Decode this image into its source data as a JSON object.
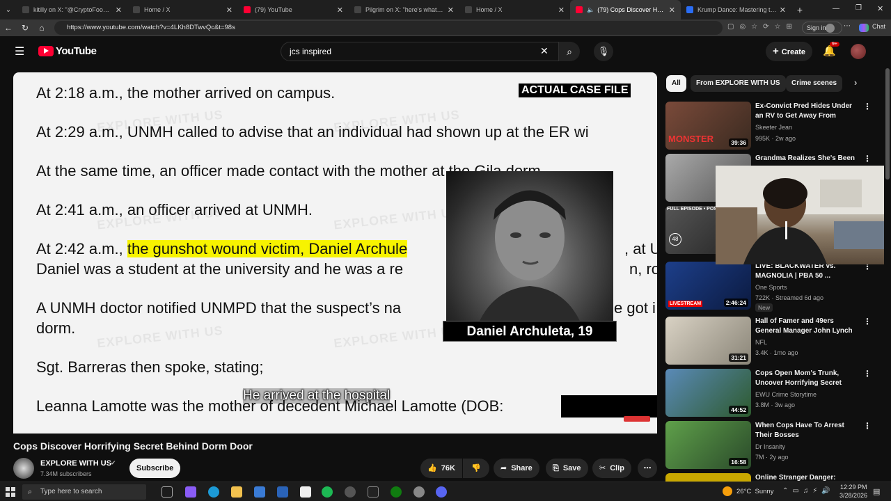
{
  "browser": {
    "tabs": [
      {
        "title": "kitilly on X: \"@CryptoFooo @Fea",
        "color": "#444"
      },
      {
        "title": "Home / X",
        "color": "#444"
      },
      {
        "title": "(79) YouTube",
        "color": "#ff0033"
      },
      {
        "title": "Pilgrim on X: \"here's what clavicul",
        "color": "#444"
      },
      {
        "title": "Home / X",
        "color": "#444"
      },
      {
        "title": "(79) Cops Discover Horrifying",
        "color": "#ff0033"
      },
      {
        "title": "Krump Dance: Mastering the Esse",
        "color": "#2a6df4"
      }
    ],
    "url": "https://www.youtube.com/watch?v=4LKh8DTwvQc&t=98s",
    "signin": "Sign in",
    "chat": "Chat"
  },
  "header": {
    "logo": "YouTube",
    "search_value": "jcs inspired",
    "create_label": "Create",
    "notif_count": "9+"
  },
  "video": {
    "case_file": "ACTUAL CASE FILE",
    "lines": [
      "At 2:18 a.m., the mother arrived on campus.",
      "At 2:29 a.m., UNMH called to advise that an individual had shown up at the ER wi",
      "At the same time, an officer made contact with the mother at the Gila dorm.",
      "At 2:41 a.m., an officer arrived at UNMH.",
      "Daniel was a student at the university and he was a re",
      "A UNMH doctor notified UNMPD that the suspect’s na",
      "dorm.",
      "Sgt. Barreras then spoke, stating;",
      "Leanna Lamotte was the mother of decedent Michael Lamotte (DOB:"
    ],
    "line5_pre": "At 2:42 a.m., ",
    "line5_hl": "the gunshot wound victim, Daniel Archule",
    "line5_tail": ", at U",
    "line6_tail": "n, roo",
    "line7_tail": "e got i",
    "watermark": "EXPLORE WITH US",
    "name_card": "Daniel Archuleta, 19",
    "subtitle": "He arrived at the hospital"
  },
  "below": {
    "title": "Cops Discover Horrifying Secret Behind Dorm Door",
    "channel": "EXPLORE WITH US",
    "subscribers": "7.34M subscribers",
    "subscribe": "Subscribe",
    "likes": "76K",
    "share": "Share",
    "save": "Save",
    "clip": "Clip"
  },
  "sidebar": {
    "chips": [
      "All",
      "From EXPLORE WITH US",
      "Crime scenes"
    ],
    "recs": [
      {
        "title": "Ex-Convict Pred Hides Under an RV to Get Away From Police!",
        "channel": "Skeeter Jean",
        "meta": "995K · 2w ago",
        "duration": "39:36",
        "thumb": "#6b3a2a"
      },
      {
        "title": "Grandma Realizes She's Been",
        "channel": "",
        "meta": "",
        "duration": "",
        "thumb": "#8a8a8a"
      },
      {
        "title": "",
        "channel": "",
        "meta": "",
        "duration": "48",
        "thumb": "#3a3a3a"
      },
      {
        "title": "LIVE: BLACKWATER vs. MAGNOLIA | PBA 50 ...",
        "channel": "One Sports",
        "meta": "722K · Streamed 6d ago",
        "duration": "2:46:24",
        "thumb": "#1d3f8a",
        "badge": "New"
      },
      {
        "title": "Hall of Famer and 49ers General Manager John Lynch",
        "channel": "NFL",
        "meta": "3.4K · 1mo ago",
        "duration": "31:21",
        "thumb": "#c9c2b4"
      },
      {
        "title": "Cops Open Mom's Trunk, Uncover Horrifying Secret",
        "channel": "EWU Crime Storytime",
        "meta": "3.8M · 3w ago",
        "duration": "44:52",
        "thumb": "#4a7aa8"
      },
      {
        "title": "When Cops Have To Arrest Their Bosses",
        "channel": "Dr Insanity",
        "meta": "7M · 2y ago",
        "duration": "16:58",
        "thumb": "#4f8f3f"
      },
      {
        "title": "Online Stranger Danger: Breck's",
        "channel": "",
        "meta": "",
        "duration": "",
        "thumb": "#c9a800"
      }
    ]
  },
  "taskbar": {
    "search_placeholder": "Type here to search",
    "weather": "26°C  Sunny",
    "time": "12:29 PM",
    "date": "3/28/2026"
  }
}
